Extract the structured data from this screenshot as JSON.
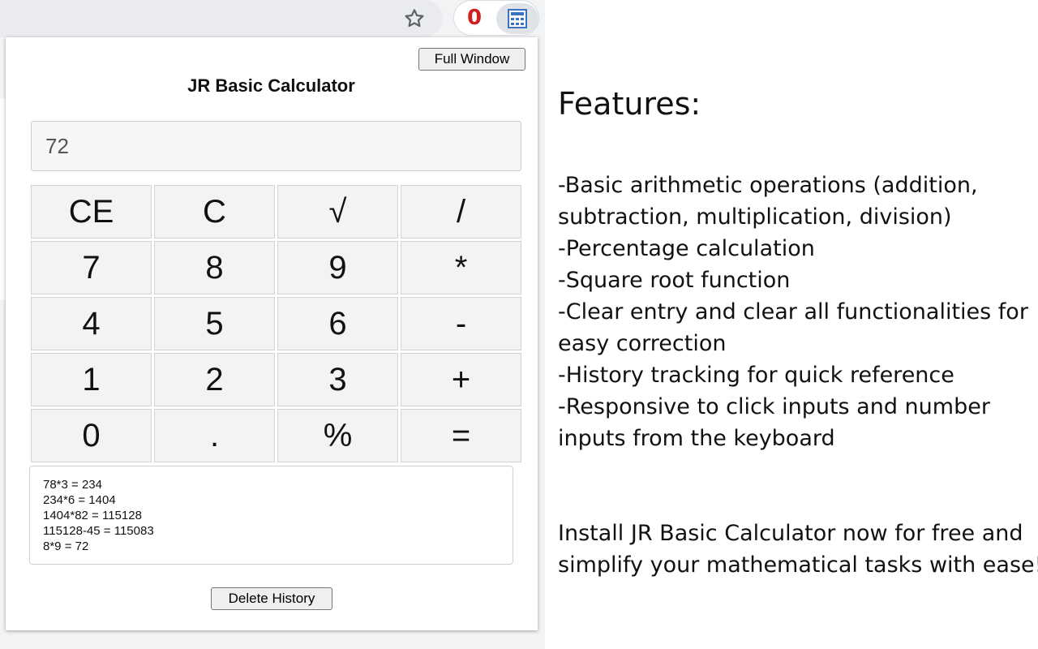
{
  "browser": {
    "star_icon": "star-outline-icon",
    "extension_badge": "0",
    "extension_badge_color": "#d01f1f",
    "calculator_extension_icon": "calculator-icon"
  },
  "calculator": {
    "full_window_label": "Full Window",
    "title": "JR Basic Calculator",
    "display_value": "72",
    "keys": [
      [
        "CE",
        "C",
        "√",
        "/"
      ],
      [
        "7",
        "8",
        "9",
        "*"
      ],
      [
        "4",
        "5",
        "6",
        "-"
      ],
      [
        "1",
        "2",
        "3",
        "+"
      ],
      [
        "0",
        ".",
        "%",
        "="
      ]
    ],
    "history": [
      "78*3 = 234",
      "234*6 = 1404",
      "1404*82 = 115128",
      "115128-45 = 115083",
      "8*9 = 72"
    ],
    "delete_history_label": "Delete History"
  },
  "features": {
    "heading": "Features:",
    "lines": [
      "-Basic arithmetic operations (addition,",
      "subtraction, multiplication, division)",
      "-Percentage calculation",
      "-Square root function",
      "-Clear entry and clear all functionalities for",
      "easy correction",
      "-History tracking for quick reference",
      "-Responsive to click inputs and number",
      "inputs from the keyboard"
    ],
    "install_lines": [
      "Install JR Basic Calculator now for free and",
      "simplify your mathematical tasks with ease!"
    ]
  }
}
